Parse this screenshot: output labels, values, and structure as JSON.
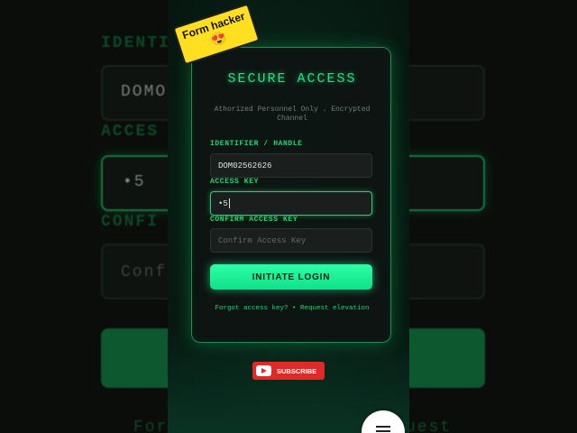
{
  "sticker": {
    "text": "Form hacker",
    "emoji": "😍"
  },
  "card": {
    "title": "SECURE ACCESS",
    "subtitle": "Athorized Personnel Only . Encrypted Channel"
  },
  "form": {
    "identifier": {
      "label": "IDENTIFIER / HANDLE",
      "value": "DOM02562626"
    },
    "access_key": {
      "label": "ACCESS KEY",
      "value": "•5"
    },
    "confirm_key": {
      "label": "CONFIRM ACCESS KEY",
      "placeholder": "Confirm Access Key"
    },
    "submit_label": "INITIATE LOGIN",
    "footer": "Forgot access key? • Request elevation"
  },
  "subscribe": {
    "label": "SUBSCRIBE"
  },
  "background": {
    "ident_label": "IDENTI",
    "ident_value": "DOMO",
    "access_label": "ACCES",
    "access_value": "•5",
    "confirm_label": "CONFI",
    "confirm_value": "Conf",
    "bottom_left": "For",
    "bottom_right": "uest"
  },
  "colors": {
    "accent": "#24e07a",
    "button": "#2cffa6",
    "subscribe": "#e02a2a",
    "sticker": "#ffdf1f"
  },
  "icons": {
    "fab": "menu-icon",
    "subscribe": "youtube-icon"
  }
}
